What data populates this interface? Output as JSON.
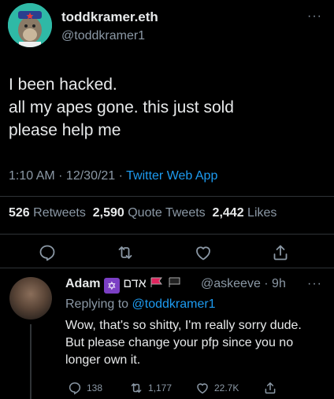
{
  "tweet": {
    "display_name": "toddkramer.eth",
    "handle": "@toddkramer1",
    "more": "···",
    "text": "I been hacked.\nall my apes gone. this just sold\nplease help me",
    "time": "1:10 AM · 12/30/21 · ",
    "source": "Twitter Web App",
    "stats": {
      "retweets_count": "526",
      "retweets_label": " Retweets  ",
      "quotes_count": "2,590",
      "quotes_label": " Quote Tweets  ",
      "likes_count": "2,442",
      "likes_label": " Likes"
    }
  },
  "reply": {
    "display_name": "Adam",
    "name_extra": "אדם",
    "handle_time": "@askeeve · 9h",
    "more": "···",
    "replying_prefix": "Replying to ",
    "replying_to": "@toddkramer1",
    "text": "Wow, that's so shitty, I'm really sorry dude. But please change your pfp since you no longer own it.",
    "replies": "138",
    "retweets": "1,177",
    "likes": "22.7K"
  },
  "colors": {
    "background": "#000000",
    "text": "#e7e9ea",
    "secondary": "#8b98a5",
    "link": "#1d9bf0"
  }
}
